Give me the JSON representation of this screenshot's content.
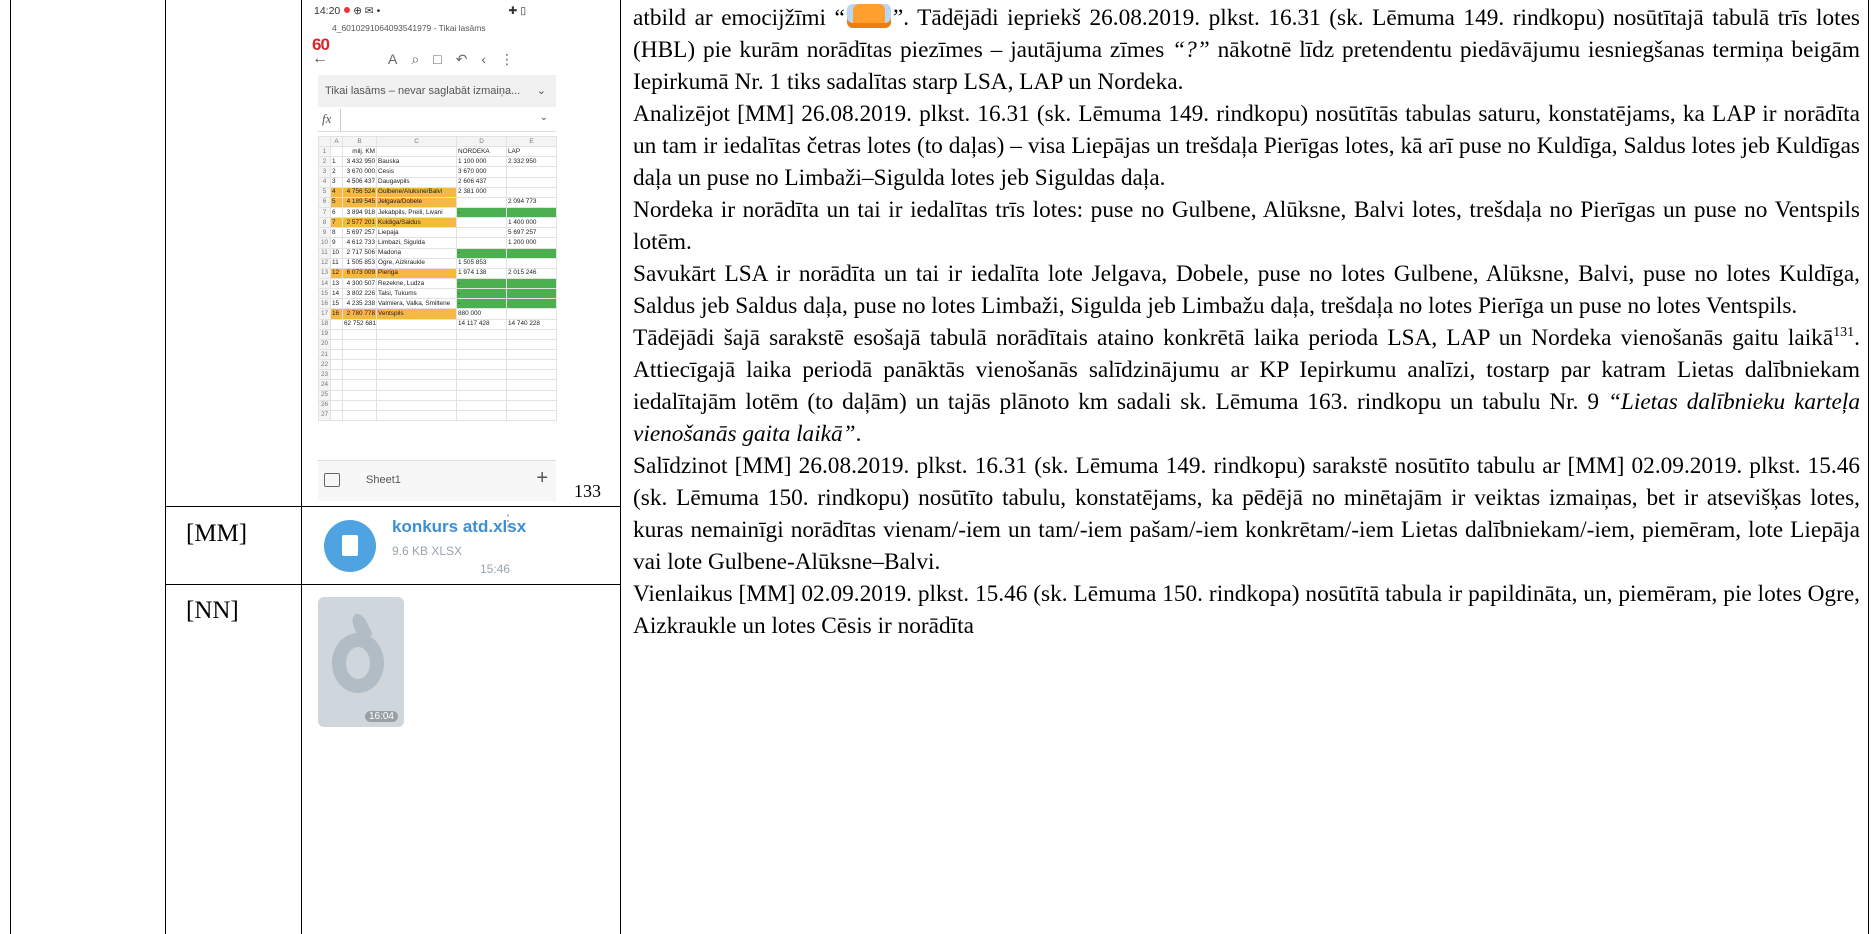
{
  "rows": [
    {
      "author": ""
    },
    {
      "author": "[MM]"
    },
    {
      "author": "[NN]"
    }
  ],
  "page_number": "133",
  "phone": {
    "status_time": "14:20",
    "status_icons": "⊕ ✉ •",
    "status_right": "✚ ▯",
    "file_title": "4_6010291064093541979 - Tikai lasāms",
    "app_logo_text": "60",
    "back_icon": "back-arrow-icon",
    "toolbar_icons": [
      "font-icon",
      "search-icon",
      "save-icon",
      "undo-icon",
      "share-icon",
      "more-icon"
    ],
    "toolbar_glyphs": "A⌕□↶‹⋮",
    "readonly_text": "Tikai lasāms – nevar saglabāt izmaiņa...",
    "fx_label": "fx",
    "sheet_tab": "Sheet1",
    "add_sheet": "+",
    "col_headers": [
      "",
      "A",
      "B",
      "C",
      "D",
      "E"
    ],
    "sheet_rows": [
      {
        "n": "1",
        "a": "",
        "b": "milj. KM",
        "c": "",
        "d": "NORDEKA",
        "e": "LAP",
        "hl": false,
        "green": ""
      },
      {
        "n": "2",
        "a": "1",
        "b": "3 432 950",
        "c": "Bauska",
        "d": "1 100 000",
        "e": "2 332 950",
        "hl": false,
        "green": ""
      },
      {
        "n": "3",
        "a": "2",
        "b": "3 670 000",
        "c": "Cesis",
        "d": "3 670 000",
        "e": "",
        "hl": false,
        "green": ""
      },
      {
        "n": "4",
        "a": "3",
        "b": "4 506 437",
        "c": "Daugavpils",
        "d": "2 606 437",
        "e": "",
        "hl": false,
        "green": ""
      },
      {
        "n": "5",
        "a": "4",
        "b": "4 756 524",
        "c": "Gulbene/Aluksne/Balvi",
        "d": "2 381 000",
        "e": "",
        "hl": true,
        "green": ""
      },
      {
        "n": "6",
        "a": "5",
        "b": "4 189 545",
        "c": "Jelgava/Dobele",
        "d": "",
        "e": "2 094 773",
        "hl": true,
        "green": ""
      },
      {
        "n": "7",
        "a": "6",
        "b": "3 894 918",
        "c": "Jekabpils, Preili, Livani",
        "d": "-",
        "e": "",
        "hl": false,
        "green": "de"
      },
      {
        "n": "8",
        "a": "7",
        "b": "2 577 201",
        "c": "Kuldiga/Saldus",
        "d": "",
        "e": "1 400 000",
        "hl": true,
        "green": ""
      },
      {
        "n": "9",
        "a": "8",
        "b": "5 697 257",
        "c": "Liepaja",
        "d": "",
        "e": "5 697 257",
        "hl": false,
        "green": ""
      },
      {
        "n": "10",
        "a": "9",
        "b": "4 612 733",
        "c": "Limbazi, Sigulda",
        "d": "",
        "e": "1 200 000",
        "hl": false,
        "green": ""
      },
      {
        "n": "11",
        "a": "10",
        "b": "2 717 506",
        "c": "Madona",
        "d": "-",
        "e": "",
        "hl": false,
        "green": "de"
      },
      {
        "n": "12",
        "a": "11",
        "b": "1 505 853",
        "c": "Ogre, Aizkraukle",
        "d": "1 505 853",
        "e": "",
        "hl": false,
        "green": ""
      },
      {
        "n": "13",
        "a": "12",
        "b": "6 073 009",
        "c": "Pieriga",
        "d": "1 974 138",
        "e": "2 015 246",
        "hl": true,
        "green": ""
      },
      {
        "n": "14",
        "a": "13",
        "b": "4 300 507",
        "c": "Rezekne, Ludza",
        "d": "-",
        "e": "",
        "hl": false,
        "green": "de"
      },
      {
        "n": "15",
        "a": "14",
        "b": "3 802 226",
        "c": "Talsi, Tukums",
        "d": "-",
        "e": "",
        "hl": false,
        "green": "de"
      },
      {
        "n": "16",
        "a": "15",
        "b": "4 235 238",
        "c": "Valmiera, Valka, Smiltene",
        "d": "-",
        "e": "",
        "hl": false,
        "green": "de"
      },
      {
        "n": "17",
        "a": "16",
        "b": "2 780 778",
        "c": "Ventspils",
        "d": "880 000",
        "e": "",
        "hl": true,
        "green": ""
      },
      {
        "n": "18",
        "a": "",
        "b": "62 752 681",
        "c": "",
        "d": "14 117 428",
        "e": "14 740 228",
        "hl": false,
        "green": ""
      },
      {
        "n": "19",
        "a": "",
        "b": "",
        "c": "",
        "d": "",
        "e": "",
        "hl": false,
        "green": ""
      },
      {
        "n": "20",
        "a": "",
        "b": "",
        "c": "",
        "d": "",
        "e": "",
        "hl": false,
        "green": ""
      },
      {
        "n": "21",
        "a": "",
        "b": "",
        "c": "",
        "d": "",
        "e": "",
        "hl": false,
        "green": ""
      },
      {
        "n": "22",
        "a": "",
        "b": "",
        "c": "",
        "d": "",
        "e": "",
        "hl": false,
        "green": ""
      },
      {
        "n": "23",
        "a": "",
        "b": "",
        "c": "",
        "d": "",
        "e": "",
        "hl": false,
        "green": ""
      },
      {
        "n": "24",
        "a": "",
        "b": "",
        "c": "",
        "d": "",
        "e": "",
        "hl": false,
        "green": ""
      },
      {
        "n": "25",
        "a": "",
        "b": "",
        "c": "",
        "d": "",
        "e": "",
        "hl": false,
        "green": ""
      },
      {
        "n": "26",
        "a": "",
        "b": "",
        "c": "",
        "d": "",
        "e": "",
        "hl": false,
        "green": ""
      },
      {
        "n": "27",
        "a": "",
        "b": "",
        "c": "",
        "d": "",
        "e": "",
        "hl": false,
        "green": ""
      }
    ]
  },
  "attachment": {
    "file_name": "konkurs atd.xlsx",
    "file_size": "9.6 KB XLSX",
    "time": "15:46",
    "icon": "document-icon"
  },
  "sticker": {
    "time": "16:04",
    "icon": "sticker-image"
  },
  "text": {
    "p1_before_emoji": "atbild ar emocijžīmi “",
    "emoji_name": "thumbs-up-emoji",
    "p1_after_emoji": "”. Tādējādi iepriekš 26.08.2019. plkst. 16.31 (sk. Lēmuma 149. rindkopu) nosūtītajā tabulā trīs lotes (HBL) pie kurām norādītas piezīmes – jautājuma zīmes ",
    "p1_question": "“?”",
    "p1_end": " nākotnē līdz pretendentu piedāvājumu iesniegšanas termiņa beigām Iepirkumā Nr. 1 tiks sadalītas starp LSA, LAP un Nordeka.",
    "p2": "Analizējot [MM] 26.08.2019. plkst. 16.31 (sk. Lēmuma 149. rindkopu) nosūtītās tabulas saturu, konstatējams, ka LAP ir norādīta un tam ir iedalītas četras lotes (to daļas) – visa Liepājas un trešdaļa Pierīgas lotes, kā arī puse no Kuldīga, Saldus lotes jeb Kuldīgas daļa un puse no Limbaži–Sigulda lotes jeb Siguldas daļa.",
    "p3": "Nordeka ir norādīta un tai ir iedalītas trīs lotes: puse no Gulbene, Alūksne, Balvi lotes, trešdaļa no Pierīgas un puse no Ventspils lotēm.",
    "p4": "Savukārt LSA ir norādīta un tai ir iedalīta lote Jelgava, Dobele, puse no lotes Gulbene, Alūksne, Balvi, puse no lotes Kuldīga, Saldus jeb Saldus daļa, puse no lotes Limbaži, Sigulda jeb Limbažu daļa, trešdaļa no lotes Pierīga un puse no lotes Ventspils.",
    "p5_a": "Tādējādi šajā sarakstē esošajā tabulā norādītais ataino konkrētā laika perioda LSA, LAP un Nordeka vienošanās gaitu laikā",
    "p5_footnote": "131",
    "p5_b": ". Attiecīgajā laika periodā panāktās vienošanās salīdzinājumu ar KP Iepirkumu analīzi, tostarp par katram Lietas dalībniekam iedalītajām lotēm (to daļām) un tajās plānoto km sadali sk. Lēmuma 163. rindkopu un tabulu Nr. 9 ",
    "p5_italic": "“Lietas dalībnieku karteļa vienošanās gaita laikā”",
    "p5_end": ".",
    "p6": "Salīdzinot [MM] 26.08.2019. plkst. 16.31 (sk. Lēmuma 149. rindkopu) sarakstē nosūtīto tabulu ar [MM] 02.09.2019. plkst. 15.46 (sk. Lēmuma 150. rindkopu) nosūtīto tabulu, konstatējams, ka pēdējā no minētajām ir veiktas izmaiņas, bet ir atsevišķas lotes, kuras nemainīgi norādītas vienam/-iem un tam/-iem pašam/-iem konkrētam/-iem Lietas dalībniekam/-iem, piemēram, lote Liepāja vai lote Gulbene-Alūksne–Balvi.",
    "p7": "Vienlaikus [MM] 02.09.2019. plkst. 15.46 (sk. Lēmuma 150. rindkopa) nosūtītā tabula ir papildināta, un, piemēram, pie lotes Ogre, Aizkraukle un lotes Cēsis ir norādīta"
  }
}
